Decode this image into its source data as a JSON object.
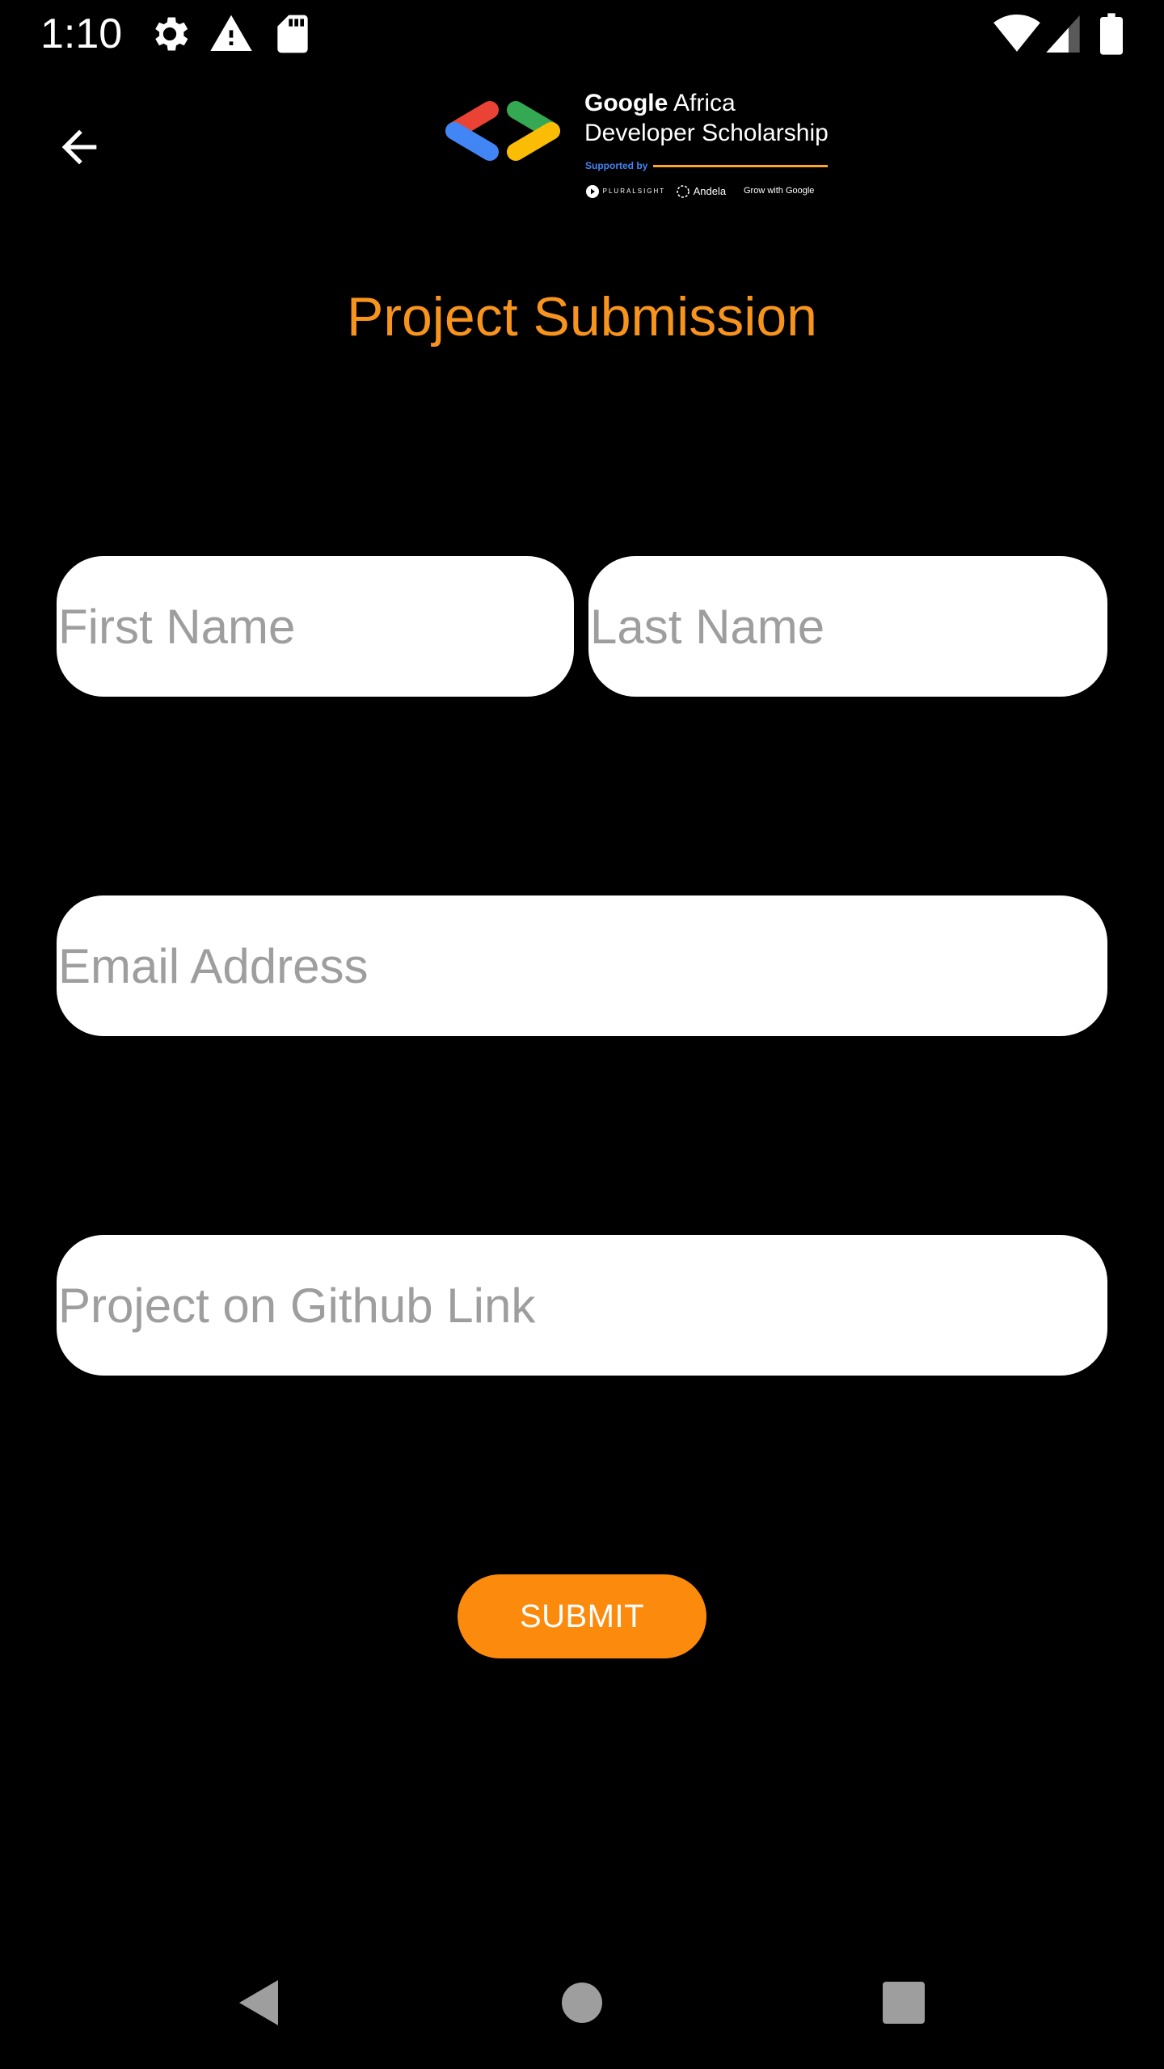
{
  "status_bar": {
    "time": "1:10",
    "left_icons": [
      "gear-icon",
      "warning-icon",
      "sd-card-icon"
    ],
    "right_icons": [
      "wifi-icon",
      "signal-icon",
      "battery-icon"
    ]
  },
  "app_bar": {
    "back_icon": "arrow-back-icon",
    "logo": {
      "line1_bold": "Google",
      "line1_rest": " Africa",
      "line2": "Developer Scholarship",
      "supported_by": "Supported by",
      "partners": [
        "PLURALSIGHT",
        "Andela",
        "Grow with Google"
      ],
      "colors": {
        "red": "#EA4335",
        "blue": "#4285F4",
        "green": "#34A853",
        "yellow": "#FBBC05"
      }
    }
  },
  "page": {
    "title": "Project Submission",
    "title_color": "#F7941D"
  },
  "form": {
    "first_name": {
      "value": "",
      "placeholder": "First Name"
    },
    "last_name": {
      "value": "",
      "placeholder": "Last Name"
    },
    "email": {
      "value": "",
      "placeholder": "Email Address"
    },
    "github_link": {
      "value": "",
      "placeholder": "Project on Github Link"
    },
    "submit_label": "SUBMIT",
    "submit_color": "#FC8A0C"
  },
  "nav_bar": {
    "icons": [
      "back-triangle-icon",
      "home-circle-icon",
      "recents-square-icon"
    ]
  }
}
